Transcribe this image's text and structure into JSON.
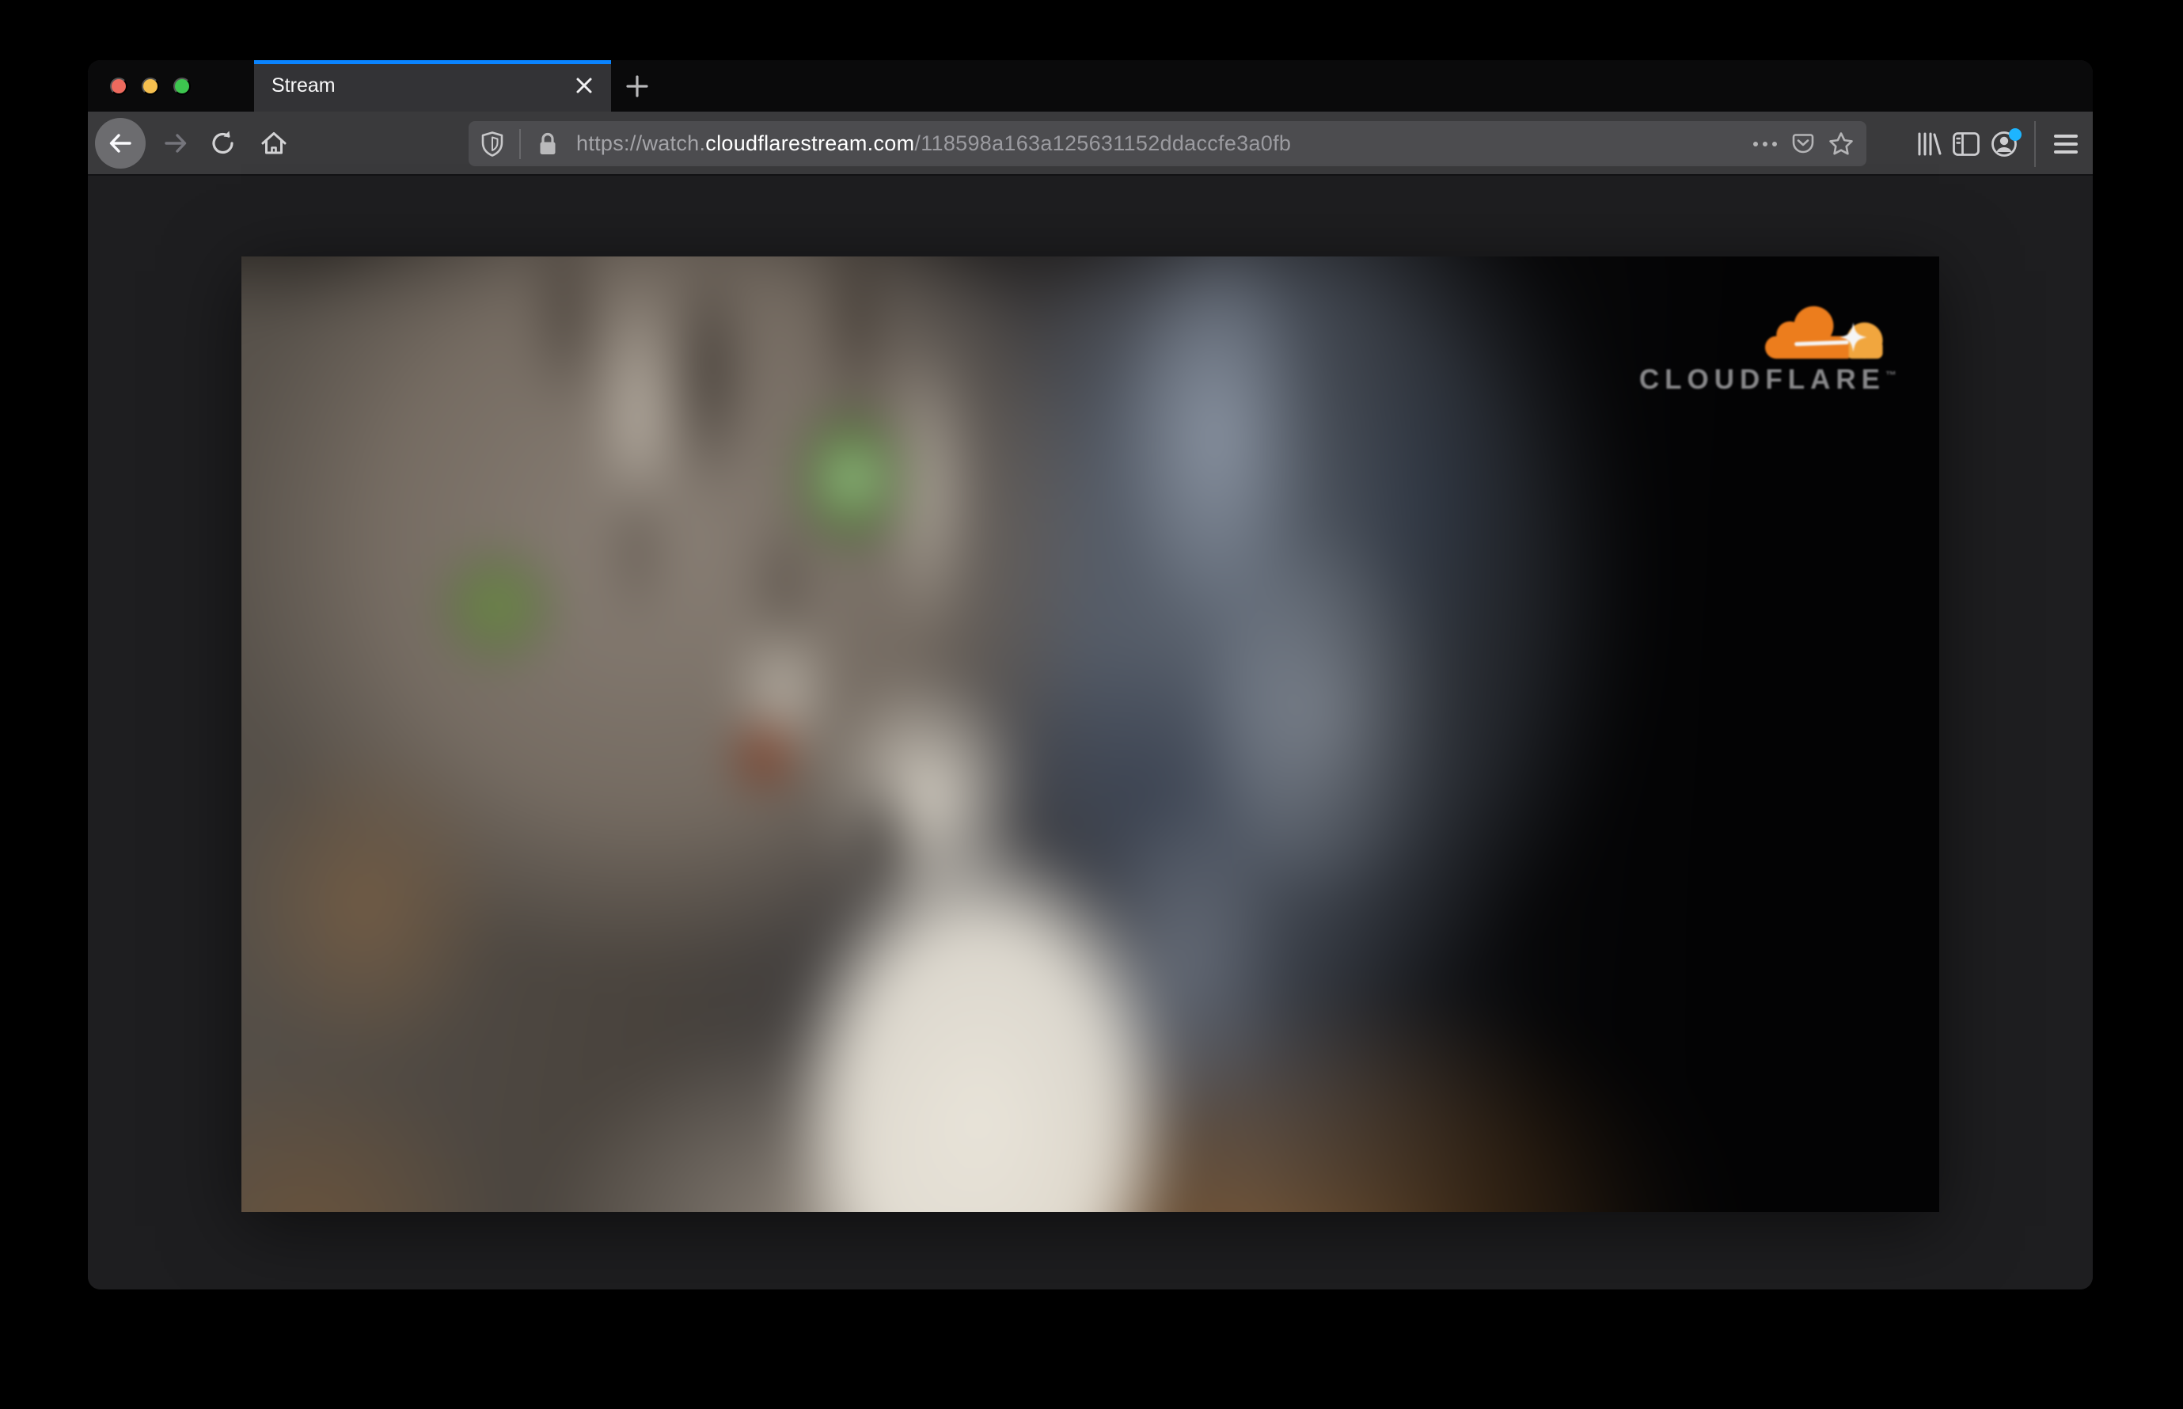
{
  "browser": {
    "traffic_lights": {
      "close": "#ed6a5e",
      "minimize": "#f5bf4f",
      "zoom": "#3dc64f"
    },
    "tab": {
      "title": "Stream",
      "accent_color": "#0a84ff"
    },
    "toolbar": {
      "url": {
        "prefix": "https://watch.",
        "domain": "cloudflarestream.com",
        "path": "/118598a163a125631152ddaccfe3a0fb"
      },
      "icons": [
        "shield-icon",
        "lock-icon",
        "ellipsis-icon",
        "pocket-icon",
        "star-icon",
        "library-icon",
        "sidebar-icon",
        "account-icon",
        "hamburger-icon"
      ],
      "notification_dot_color": "#1db5ff"
    }
  },
  "page": {
    "brand": {
      "name": "CLOUDFLARE",
      "mark": "™",
      "orange": "#f6821f",
      "orange_light": "#fbad41"
    }
  }
}
